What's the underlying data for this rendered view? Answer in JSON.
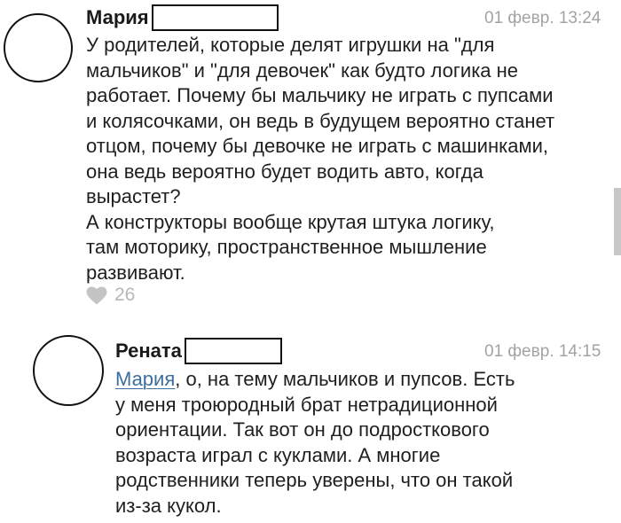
{
  "comments": [
    {
      "author": "Мария",
      "date": "01 февр. 13:24",
      "text_lines": [
        "У родителей, которые делят игрушки на \"для",
        "мальчиков\" и \"для девочек\" как будто логика не",
        "работает. Почему бы мальчику не играть с пупсами",
        "и колясочками, он ведь в будущем вероятно станет",
        "отцом, почему бы девочке не играть с машинками,",
        "она ведь вероятно будет водить авто, когда",
        "вырастет?",
        "А конструкторы вообще крутая штука логику,",
        "там моторику, пространственное мышление",
        "развивают."
      ],
      "likes": "26",
      "like_icon": "heart-icon"
    },
    {
      "author": "Рената",
      "date": "01 февр. 14:15",
      "mention": "Мария",
      "first_line_rest": ", о, на тему мальчиков и пупсов. Есть",
      "text_lines": [
        "у меня троюродный брат нетрадиционной",
        "ориентации. Так вот он до подросткового",
        "возраста играл с куклами. А многие",
        "родственники теперь уверены, что он такой",
        "из-за кукол."
      ]
    }
  ],
  "colors": {
    "mention": "#3c6e9e",
    "date": "#a3a3a3",
    "likes": "#b8b8b8"
  }
}
